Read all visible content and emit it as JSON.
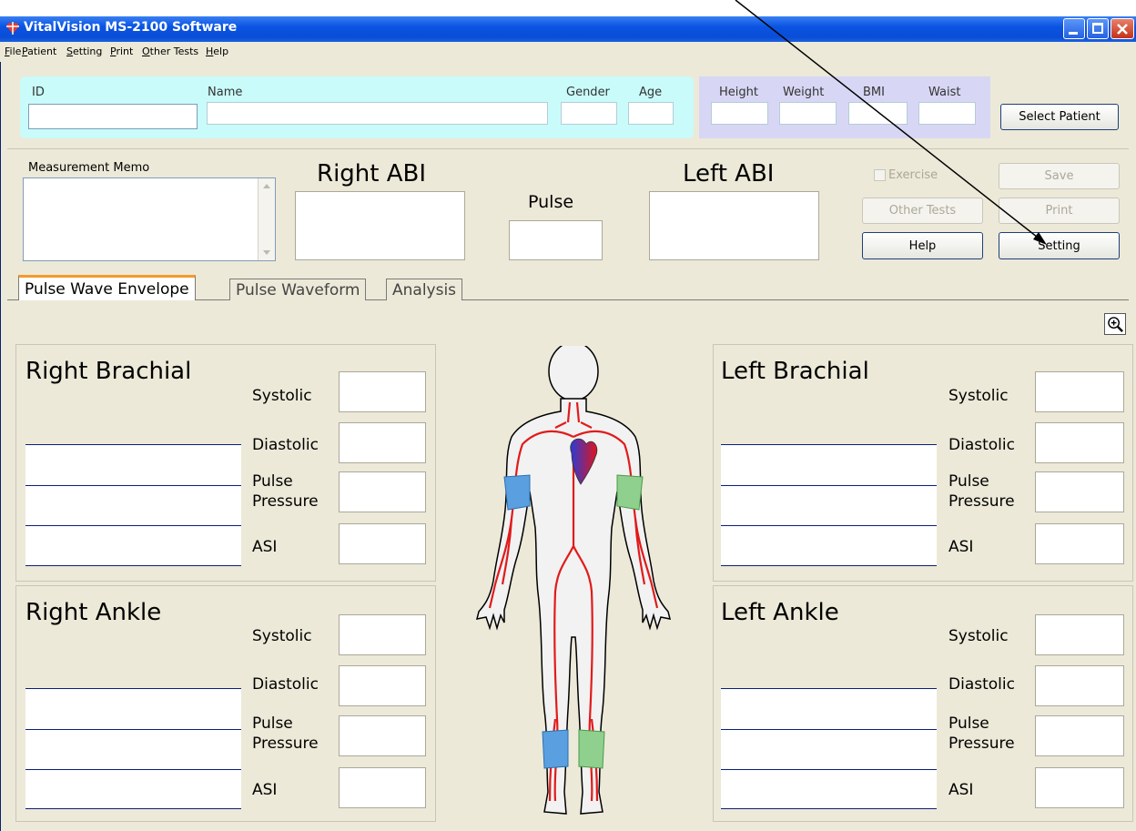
{
  "window": {
    "title": "VitalVision MS-2100 Software",
    "accent": "#0a54e3"
  },
  "menu": [
    "File",
    "Patient",
    "Setting",
    "Print",
    "Other Tests",
    "Help"
  ],
  "patient": {
    "id_label": "ID",
    "name_label": "Name",
    "gender_label": "Gender",
    "age_label": "Age",
    "height_label": "Height",
    "weight_label": "Weight",
    "bmi_label": "BMI",
    "waist_label": "Waist",
    "select_button": "Select Patient",
    "id_value": "",
    "name_value": "",
    "gender_value": "",
    "age_value": "",
    "height_value": "",
    "weight_value": "",
    "bmi_value": "",
    "waist_value": ""
  },
  "measurement": {
    "memo_label": "Measurement Memo",
    "memo_value": "",
    "right_abi_label": "Right ABI",
    "right_abi_value": "",
    "pulse_label": "Pulse",
    "pulse_value": "",
    "left_abi_label": "Left ABI",
    "left_abi_value": ""
  },
  "actions": {
    "exercise_label": "Exercise",
    "exercise_checked": false,
    "save": "Save",
    "other_tests": "Other Tests",
    "print": "Print",
    "help": "Help",
    "setting": "Setting"
  },
  "tabs": [
    "Pulse Wave Envelope",
    "Pulse Waveform",
    "Analysis"
  ],
  "active_tab": "Pulse Wave Envelope",
  "zoom_icon": "zoom-in-icon",
  "sites": {
    "right_brachial": {
      "title": "Right Brachial",
      "systolic": "Systolic",
      "diastolic": "Diastolic",
      "pulse_pressure": "Pulse\nPressure",
      "asi": "ASI"
    },
    "right_ankle": {
      "title": "Right Ankle",
      "systolic": "Systolic",
      "diastolic": "Diastolic",
      "pulse_pressure": "Pulse\nPressure",
      "asi": "ASI"
    },
    "left_brachial": {
      "title": "Left Brachial",
      "systolic": "Systolic",
      "diastolic": "Diastolic",
      "pulse_pressure": "Pulse\nPressure",
      "asi": "ASI"
    },
    "left_ankle": {
      "title": "Left Ankle",
      "systolic": "Systolic",
      "diastolic": "Diastolic",
      "pulse_pressure": "Pulse\nPressure",
      "asi": "ASI"
    }
  },
  "cuff_colors": {
    "right": "#5aa0e0",
    "left": "#8fd08f"
  }
}
